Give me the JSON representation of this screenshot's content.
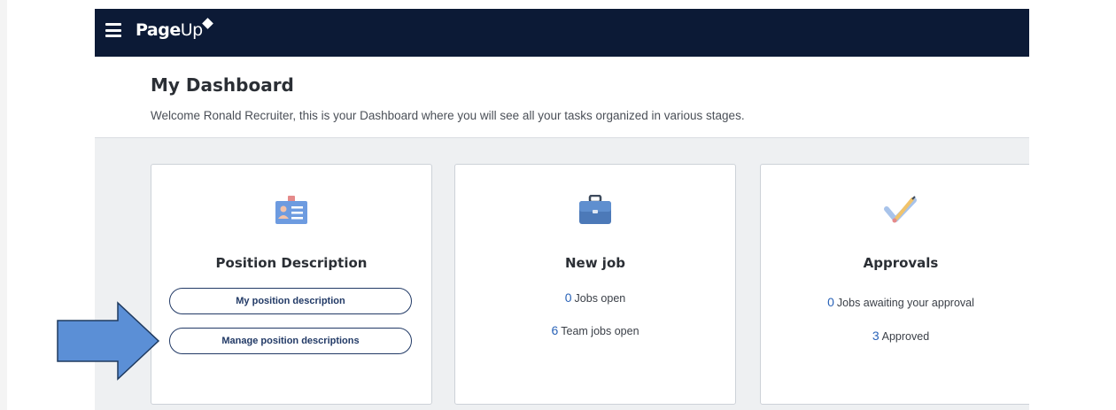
{
  "app": {
    "logo_text_bold": "Page",
    "logo_text_light": "Up"
  },
  "header": {
    "title": "My Dashboard",
    "welcome": "Welcome Ronald Recruiter, this is your Dashboard where you will see all your tasks organized in various stages."
  },
  "cards": [
    {
      "title": "Position Description",
      "icon": "id-card-icon",
      "buttons": [
        "My position description",
        "Manage position descriptions"
      ]
    },
    {
      "title": "New job",
      "icon": "briefcase-icon",
      "stats": [
        {
          "value": "0",
          "label": "Jobs open"
        },
        {
          "value": "6",
          "label": "Team jobs open"
        }
      ]
    },
    {
      "title": "Approvals",
      "icon": "checkmark-pencil-icon",
      "stats": [
        {
          "value": "0",
          "label": "Jobs awaiting your approval"
        },
        {
          "value": "3",
          "label": "Approved"
        }
      ]
    }
  ],
  "annotation": {
    "icon": "pointer-arrow-icon",
    "color": "#5b8fd6"
  },
  "colors": {
    "topbar": "#0c1a36",
    "accent_number": "#2a63b8",
    "button_border": "#223a66"
  }
}
